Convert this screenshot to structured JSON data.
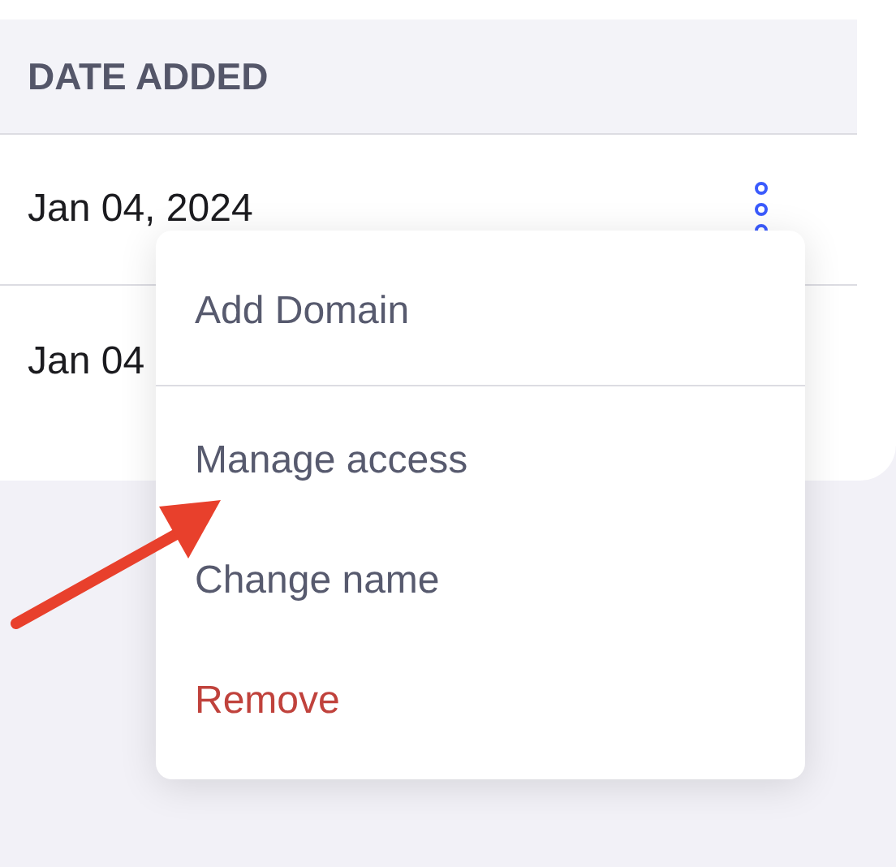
{
  "table": {
    "columns": [
      "DATE ADDED"
    ],
    "rows": [
      {
        "date": "Jan 04, 2024",
        "menu_open": true
      },
      {
        "date": "Jan 04",
        "menu_open": false
      }
    ]
  },
  "menu": {
    "items": [
      {
        "label": "Add Domain",
        "kind": "normal"
      },
      {
        "label": "Manage access",
        "kind": "normal"
      },
      {
        "label": "Change name",
        "kind": "normal"
      },
      {
        "label": "Remove",
        "kind": "danger"
      }
    ]
  }
}
